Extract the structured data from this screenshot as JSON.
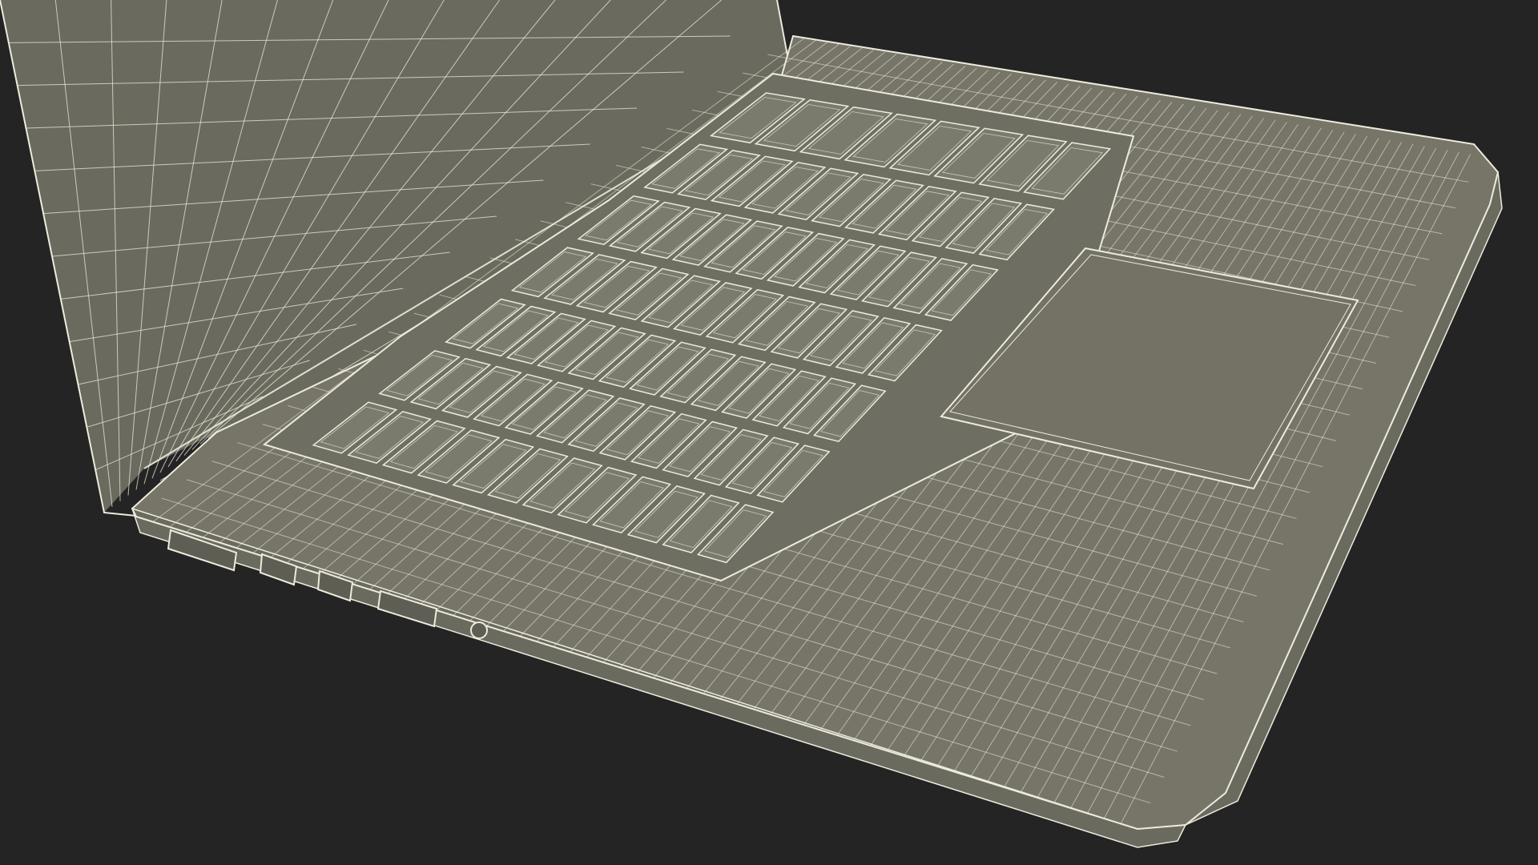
{
  "scene": {
    "subject": "laptop-wireframe-render",
    "background_color": "#242424",
    "surface_color": "#767567",
    "surface_shade_color": "#6b6a5e",
    "wire_color": "#ecebdd",
    "port_fill_color": "#5f5e54"
  },
  "parts": {
    "keyboard_rows": 7,
    "keys_per_row": [
      12,
      13,
      13,
      12,
      12,
      11,
      8
    ],
    "ports": [
      "usb-port",
      "thunderbolt-port",
      "thunderbolt-port",
      "hdmi-port",
      "headphone-jack"
    ]
  }
}
